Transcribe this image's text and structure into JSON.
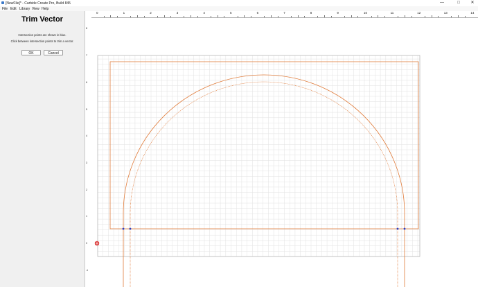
{
  "window": {
    "title": "[NewFile]* - Carbide Create Pro, Build 845",
    "minimize": "—",
    "maximize": "□",
    "close": "✕"
  },
  "menu": [
    "File",
    "Edit",
    "Library",
    "View",
    "Help"
  ],
  "panel": {
    "title": "Trim Vector",
    "line1": "Intersection points are shown in blue.",
    "line2": "Click between intersection points to trim a vector.",
    "ok": "OK",
    "cancel": "Cancel"
  },
  "ruler_x_labels": [
    "0",
    "1",
    "2",
    "3",
    "4",
    "5",
    "6",
    "7",
    "8",
    "9",
    "10",
    "11",
    "12",
    "13",
    "14"
  ],
  "ruler_y_labels": [
    "8",
    "7",
    "6",
    "5",
    "4",
    "3",
    "2",
    "1",
    "0",
    "-1"
  ],
  "colors": {
    "vector": "#e07b39",
    "grid": "#e2e2e2",
    "intersection": "#2a3fc8",
    "origin": "#d62020"
  }
}
